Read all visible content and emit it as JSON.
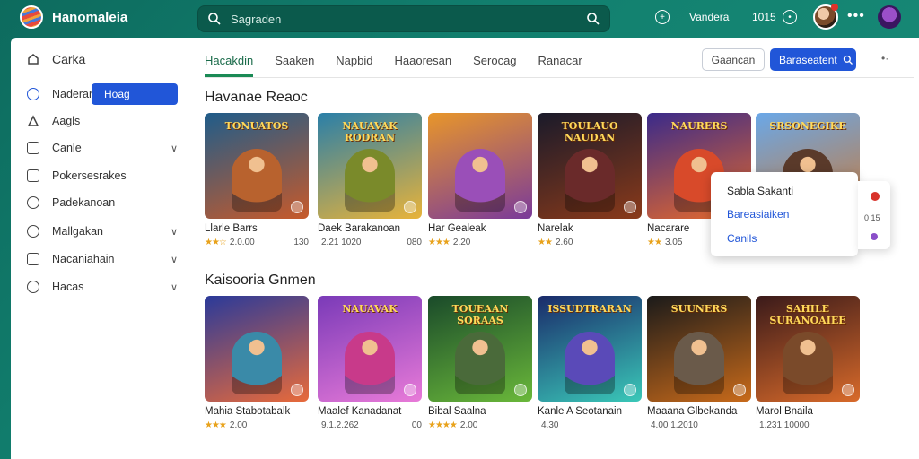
{
  "app": {
    "title": "Hanomaleia"
  },
  "search": {
    "placeholder": "Sagraden"
  },
  "topbar": {
    "label1": "Vandera",
    "label2": "1015"
  },
  "sidebar": {
    "title": "Carka",
    "items": [
      {
        "label": "Naderar",
        "pill": "Hoag"
      },
      {
        "label": "Aagls"
      },
      {
        "label": "Canle"
      },
      {
        "label": "Pokersesrakes"
      },
      {
        "label": "Padekanoan"
      },
      {
        "label": "Mallgakan"
      },
      {
        "label": "Nacaniahain"
      },
      {
        "label": "Hacas"
      }
    ]
  },
  "tabs": [
    {
      "label": "Hacakdin"
    },
    {
      "label": "Saaken"
    },
    {
      "label": "Napbid"
    },
    {
      "label": "Haaoresan"
    },
    {
      "label": "Serocag"
    },
    {
      "label": "Ranacar"
    }
  ],
  "actions": {
    "outline_btn": "Gaancan",
    "blue_btn": "Baraseatent"
  },
  "sections": [
    {
      "title": "Havanae Reaoc",
      "cards": [
        {
          "name": "Llarle Barrs",
          "stars": "★★☆",
          "meta": "2.0.00",
          "right": "130",
          "banner": "TONUATOS",
          "bg": [
            "#1f5c8a",
            "#c75a2a"
          ],
          "fig": "#b8622e"
        },
        {
          "name": "Daek Barakanoan",
          "stars": "",
          "meta": "2.21 1020",
          "right": "080",
          "banner": "NAUAVAK RODRAN",
          "bg": [
            "#2a7fa8",
            "#e8b33a"
          ],
          "fig": "#7a8a2a"
        },
        {
          "name": "Har Gealeak",
          "stars": "★★★",
          "meta": "2.20",
          "right": "",
          "banner": "",
          "bg": [
            "#e8962a",
            "#7a3a9a"
          ],
          "fig": "#9a4fb8"
        },
        {
          "name": "Narelak",
          "stars": "★★",
          "meta": "2.60",
          "right": "",
          "banner": "TOULAUO NAUDAN",
          "bg": [
            "#1a1a2a",
            "#8a3a1a"
          ],
          "fig": "#6a2a2a"
        },
        {
          "name": "Nacarare",
          "stars": "★★",
          "meta": "3.05",
          "right": "",
          "banner": "NAURERS",
          "bg": [
            "#3a2a8a",
            "#e86a2a"
          ],
          "fig": "#d84a2a"
        },
        {
          "name": "",
          "stars": "",
          "meta": "",
          "right": "",
          "banner": "SRSONEGIKE",
          "bg": [
            "#6aa8e8",
            "#c87a3a"
          ],
          "fig": "#5a3a2a"
        }
      ]
    },
    {
      "title": "Kaisooria Gnmen",
      "cards": [
        {
          "name": "Mahia Stabotabalk",
          "stars": "★★★",
          "meta": "2.00",
          "right": "",
          "banner": "",
          "bg": [
            "#2a3a9a",
            "#e86a3a"
          ],
          "fig": "#3a8aa8"
        },
        {
          "name": "Maalef Kanadanat",
          "stars": "",
          "meta": "9.1.2.262",
          "right": "00",
          "banner": "NAUAVAK",
          "bg": [
            "#7a3ab8",
            "#e87ad8"
          ],
          "fig": "#c83a8a"
        },
        {
          "name": "Bibal Saalna",
          "stars": "★★★★",
          "meta": "2.00",
          "right": "",
          "banner": "TOUEAAN SORAAS",
          "bg": [
            "#1a4a2a",
            "#6ab83a"
          ],
          "fig": "#4a6a3a"
        },
        {
          "name": "Kanle A Seotanain",
          "stars": "",
          "meta": "4.30",
          "right": "",
          "banner": "ISSUDTRARAN",
          "bg": [
            "#1a2a6a",
            "#3ac8b8"
          ],
          "fig": "#5a4ab8"
        },
        {
          "name": "Maaana Glbekanda",
          "stars": "",
          "meta": "4.00 1.2010",
          "right": "",
          "banner": "SUUNERS",
          "bg": [
            "#1a1a1a",
            "#c86a1a"
          ],
          "fig": "#6a5a4a"
        },
        {
          "name": "Marol Bnaila",
          "stars": "",
          "meta": "1.231.10000",
          "right": "",
          "banner": "SAHILE SURANOAIEE",
          "bg": [
            "#3a1a1a",
            "#d86a2a"
          ],
          "fig": "#7a4a2a"
        }
      ]
    }
  ],
  "popup": {
    "item1": "Sabla Sakanti",
    "item2": "Bareasiaiken",
    "item3": "Canils"
  },
  "side_card": {
    "text": "0 15"
  },
  "colors": {
    "accent_blue": "#2156d8",
    "brand_green": "#0d6b5e",
    "star": "#e8a21b"
  }
}
